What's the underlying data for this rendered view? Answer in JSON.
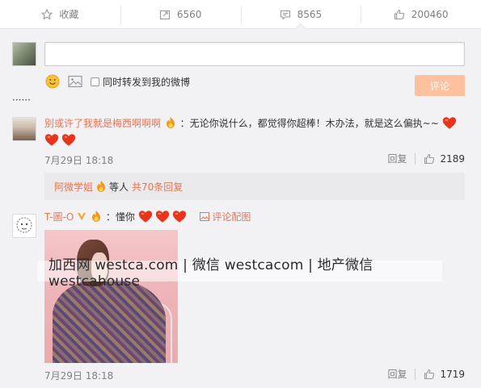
{
  "action_bar": {
    "favorite": "收藏",
    "repost_count": "6560",
    "comment_count": "8565",
    "like_count": "200460"
  },
  "composer": {
    "sync_label": "同时转发到我的微博",
    "submit_label": "评论"
  },
  "comments": [
    {
      "username": "别或许了我就是梅西啊啊啊",
      "text": "：无论你说什么，都觉得你超棒！木办法，就是这么偏执~~",
      "time": "7月29日 18:18",
      "reply_label": "回复",
      "like_count": "2189",
      "sub_replies": {
        "user": "阿微学姐",
        "middle": "等人",
        "more": "共70条回复"
      }
    },
    {
      "username": "T-圖-O",
      "text": "：懂你",
      "image_comment_label": "评论配图",
      "time": "7月29日 18:18",
      "reply_label": "回复",
      "like_count": "1719"
    }
  ],
  "watermark": "加西网 westca.com | 微信 westcacom | 地产微信 westcahouse",
  "colors": {
    "accent": "#eb7350",
    "submit_bg": "#ffc09f",
    "panel_bg": "#f2f2f5"
  }
}
